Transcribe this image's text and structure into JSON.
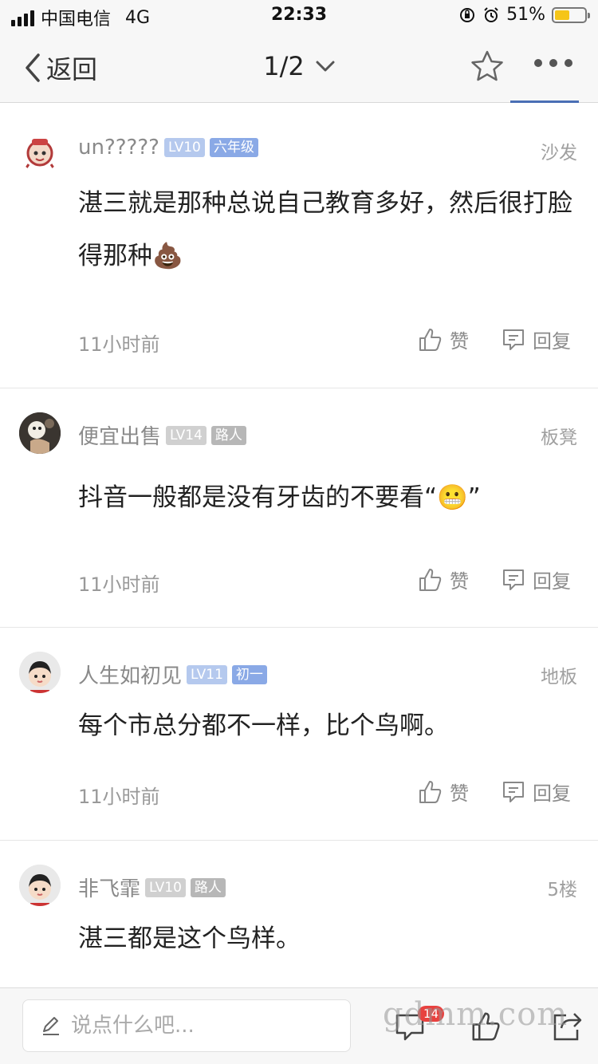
{
  "status_bar": {
    "carrier": "中国电信",
    "network": "4G",
    "time": "22:33",
    "battery_percent": "51%",
    "battery_level": 0.51
  },
  "nav": {
    "back_label": "返回",
    "page_indicator": "1/2"
  },
  "comments": [
    {
      "username": "un?????",
      "level": "LV10",
      "grade": "六年级",
      "floor": "沙发",
      "text": "湛三就是那种总说自己教育多好，然后很打脸得那种",
      "emoji": "💩",
      "time": "11小时前",
      "like_label": "赞",
      "reply_label": "回复"
    },
    {
      "username": "便宜出售",
      "level": "LV14",
      "grade": "路人",
      "floor": "板凳",
      "text": "抖音一般都是没有牙齿的不要看“",
      "emoji": "😬",
      "text_suffix": "”",
      "time": "11小时前",
      "like_label": "赞",
      "reply_label": "回复"
    },
    {
      "username": "人生如初见",
      "level": "LV11",
      "grade": "初一",
      "floor": "地板",
      "text": "每个市总分都不一样，比个鸟啊。",
      "time": "11小时前",
      "like_label": "赞",
      "reply_label": "回复"
    },
    {
      "username": "非飞霏",
      "level": "LV10",
      "grade": "路人",
      "floor": "5楼",
      "text": "湛三都是这个鸟样。"
    }
  ],
  "bottom_bar": {
    "input_placeholder": "说点什么吧...",
    "comment_badge": "14",
    "watermark": "gdmm.com"
  },
  "icons": {
    "back": "chevron-left-icon",
    "dropdown": "chevron-down-icon",
    "star": "star-icon",
    "more": "more-dots-icon",
    "like": "thumbs-up-icon",
    "reply": "comment-bubble-icon",
    "edit": "pencil-icon",
    "share": "share-icon"
  },
  "colors": {
    "level_badge_blue": "#b5c9ee",
    "grade_badge_blue": "#8aa9e6",
    "badge_gray": "#d0d0d0",
    "nav_underline": "#4a6fb5",
    "notification_red": "#e8413f"
  }
}
